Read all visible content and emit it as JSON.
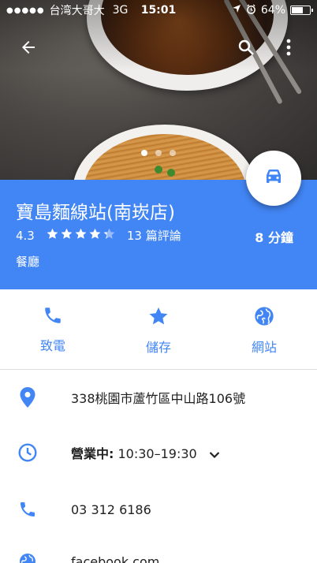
{
  "status_bar": {
    "signal": "●●●●●",
    "carrier": "台湾大哥大",
    "network": "3G",
    "time": "15:01",
    "battery": "64%",
    "battery_level": 0.64
  },
  "carousel": {
    "count": 3,
    "active_index": 0
  },
  "place": {
    "name": "寶島麵線站(南崁店)",
    "rating": "4.3",
    "rating_value": 4.3,
    "reviews": "13 篇評論",
    "eta": "8 分鐘",
    "category": "餐廳"
  },
  "actions": [
    {
      "label": "致電",
      "icon": "phone-icon"
    },
    {
      "label": "儲存",
      "icon": "star-icon"
    },
    {
      "label": "網站",
      "icon": "globe-icon"
    }
  ],
  "info": {
    "address": "338桃園市蘆竹區中山路106號",
    "hours_status": "營業中:",
    "hours": "10:30–19:30",
    "phone": "03 312 6186",
    "website": "facebook.com"
  },
  "colors": {
    "accent": "#4285f4",
    "text": "#212121"
  }
}
